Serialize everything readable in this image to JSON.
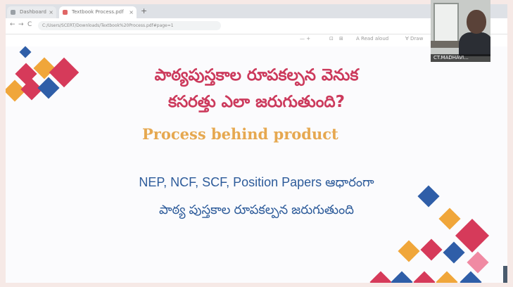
{
  "browser": {
    "tabs": [
      {
        "label": "Dashboard"
      },
      {
        "label": "Textbook Process.pdf"
      }
    ],
    "new_tab_symbol": "+",
    "url": "C:/Users/SCERT/Downloads/Textbook%20Process.pdf#page=1",
    "back_symbol": "←",
    "forward_symbol": "→",
    "reload_symbol": "C"
  },
  "pdf_toolbar": {
    "page_nav": "—   +",
    "fit_label": "⊡",
    "zoom_label": "⊞",
    "read_aloud": "A  Read aloud",
    "draw_label": "∀  Draw"
  },
  "slide": {
    "title_line1": "పాఠ్యపుస్తకాల రూపకల్పన వెనుక",
    "title_line2": "కసరత్తు ఎలా జరుగుతుంది?",
    "subtitle": "Process behind product",
    "body_line1": "NEP, NCF, SCF, Position Papers ఆధారంగా",
    "body_line2": "పాఠ్య పుస్తకాల రూపకల్పన జరుగుతుంది",
    "colors": {
      "title": "#cc3a5c",
      "subtitle": "#e6a850",
      "body": "#2d5b9a",
      "diamond_red": "#d63a5a",
      "diamond_blue": "#2f5ea8",
      "diamond_orange": "#f0a63a",
      "diamond_pink": "#f08aa3"
    }
  },
  "webcam": {
    "participant_name": "CT.MADHAVI..."
  }
}
